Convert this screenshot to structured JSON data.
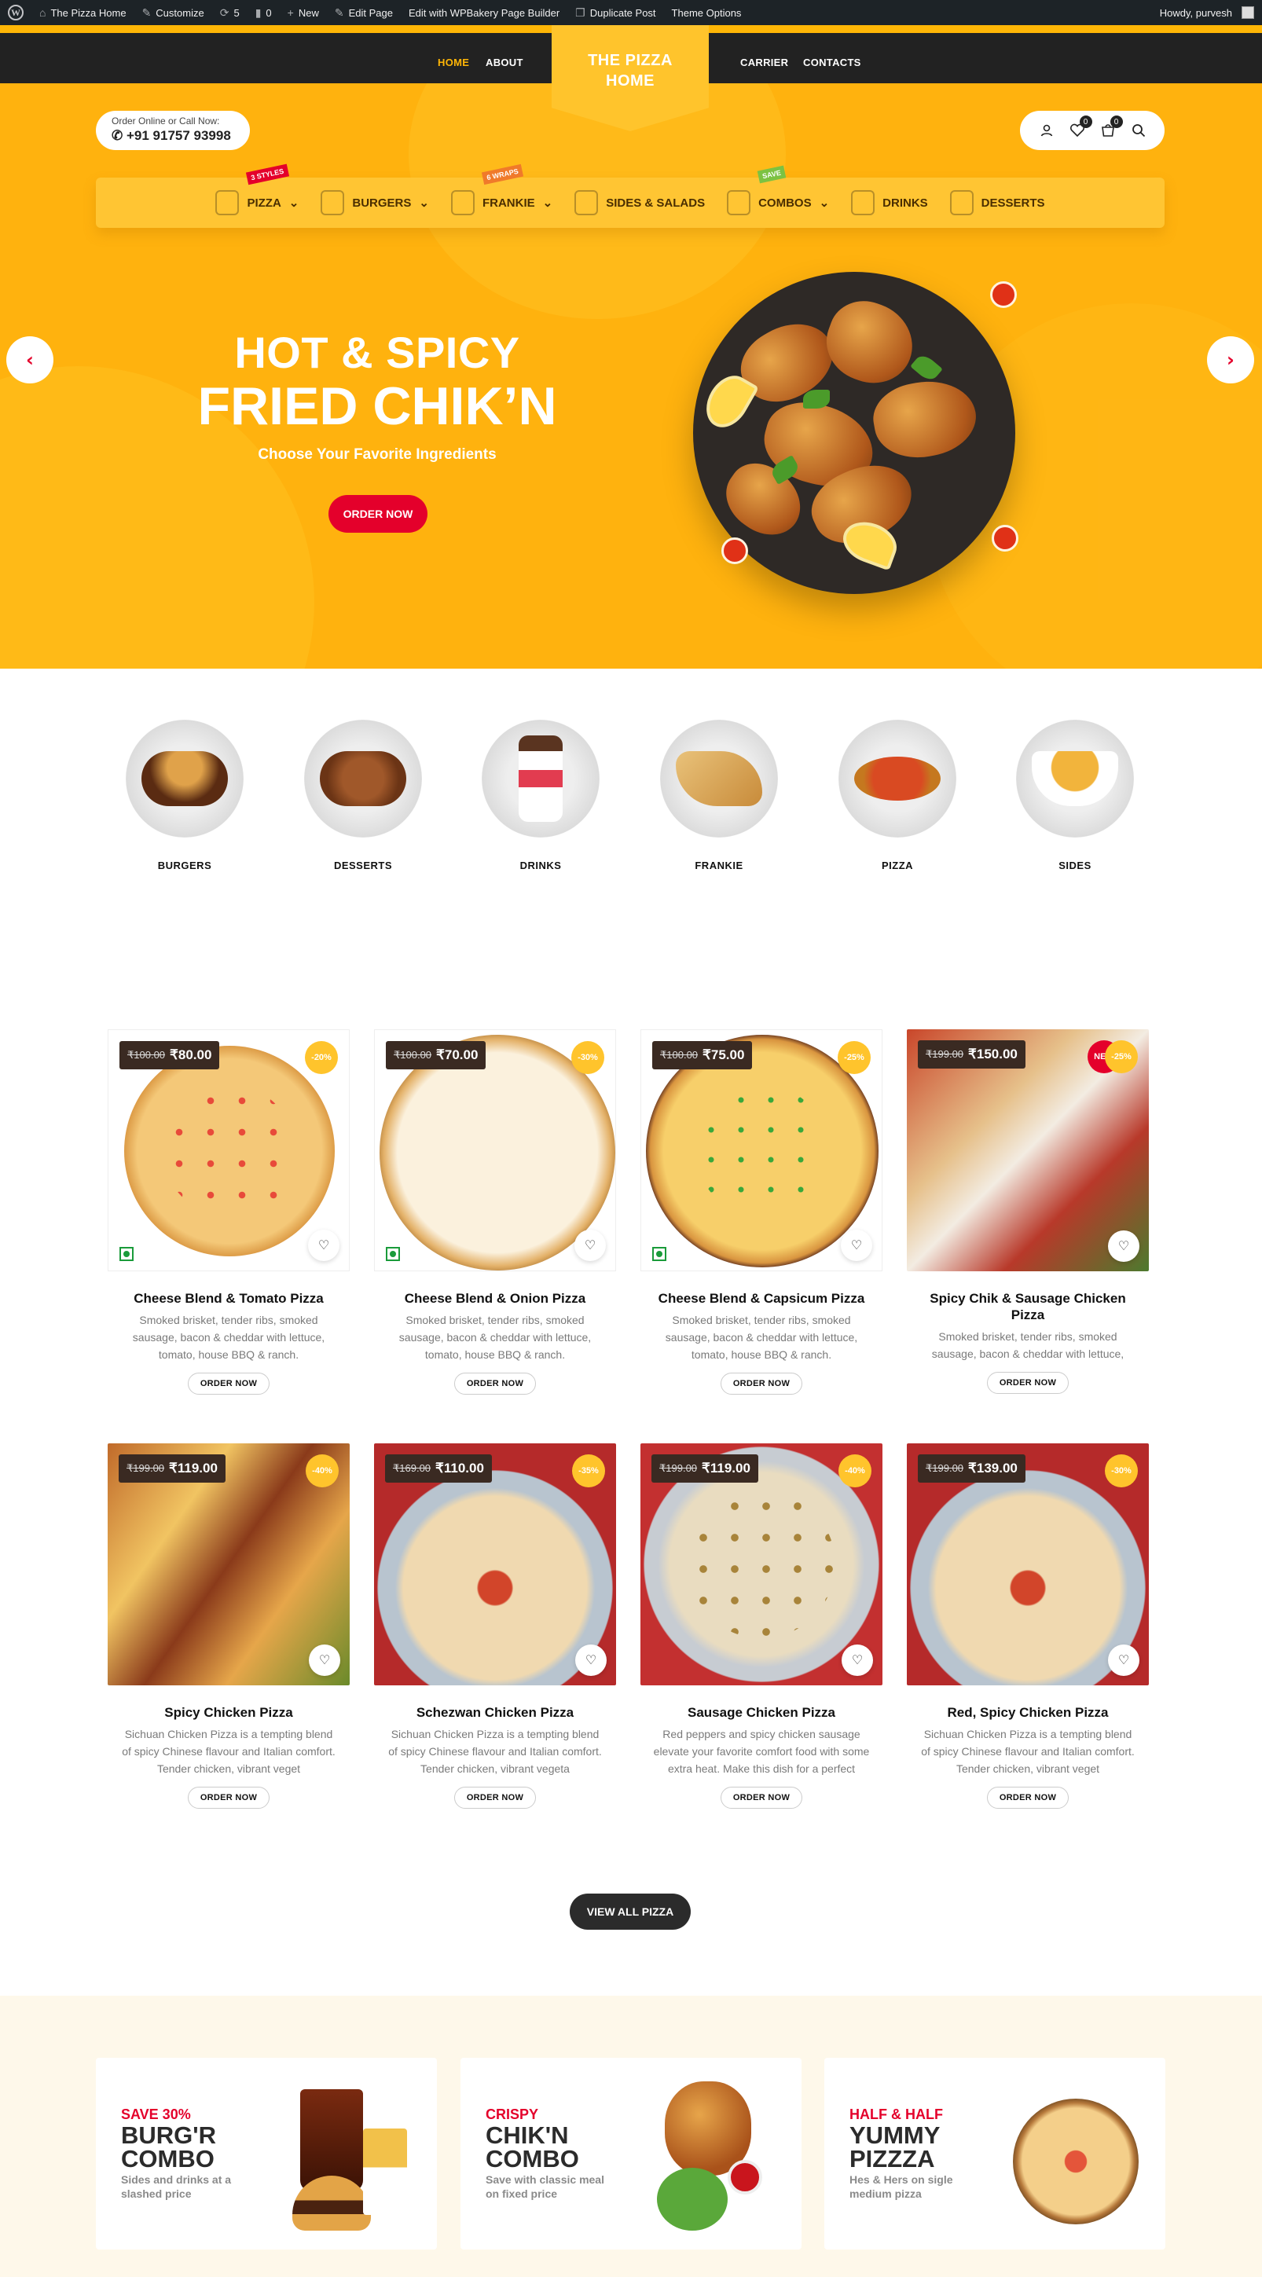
{
  "adminbar": {
    "site": "The Pizza Home",
    "customize": "Customize",
    "updates": "5",
    "comments": "0",
    "new": "New",
    "edit_page": "Edit Page",
    "wpbakery": "Edit with WPBakery Page Builder",
    "duplicate": "Duplicate Post",
    "theme_options": "Theme Options",
    "howdy": "Howdy, purvesh"
  },
  "nav": {
    "home": "HOME",
    "about": "ABOUT",
    "carrier": "CARRIER",
    "contacts": "CONTACTS",
    "logo_line1": "THE PIZZA",
    "logo_line2": "HOME"
  },
  "header": {
    "order_label": "Order Online or Call Now:",
    "phone": "+91 91757 93998",
    "wishlist_count": "0",
    "cart_count": "0"
  },
  "menu": [
    {
      "label": "PIZZA",
      "caret": "⌄",
      "tag": "3 STYLES",
      "tag_color": "#e4002b"
    },
    {
      "label": "BURGERS",
      "caret": "⌄",
      "tag": "",
      "tag_color": ""
    },
    {
      "label": "FRANKIE",
      "caret": "⌄",
      "tag": "6 WRAPS",
      "tag_color": "#f07a2a"
    },
    {
      "label": "SIDES & SALADS",
      "caret": "",
      "tag": "",
      "tag_color": ""
    },
    {
      "label": "COMBOS",
      "caret": "⌄",
      "tag": "SAVE",
      "tag_color": "#7cc242"
    },
    {
      "label": "DRINKS",
      "caret": "",
      "tag": "",
      "tag_color": ""
    },
    {
      "label": "DESSERTS",
      "caret": "",
      "tag": "",
      "tag_color": ""
    }
  ],
  "hero": {
    "title1": "HOT & SPICY",
    "title2": "FRIED CHIK’N",
    "subtitle": "Choose Your Favorite Ingredients",
    "button": "ORDER NOW",
    "prev": "‹",
    "next": "›"
  },
  "categories": [
    {
      "label": "BURGERS"
    },
    {
      "label": "DESSERTS"
    },
    {
      "label": "DRINKS"
    },
    {
      "label": "FRANKIE"
    },
    {
      "label": "PIZZA"
    },
    {
      "label": "SIDES"
    }
  ],
  "products": [
    {
      "name": "Cheese Blend & Tomato Pizza",
      "old_price": "₹100.00",
      "price": "₹80.00",
      "badge": "-20%",
      "desc": "Smoked brisket, tender ribs, smoked sausage, bacon & cheddar with lettuce, tomato, house BBQ & ranch.",
      "button": "ORDER NOW"
    },
    {
      "name": "Cheese Blend & Onion Pizza",
      "old_price": "₹100.00",
      "price": "₹70.00",
      "badge": "-30%",
      "desc": "Smoked brisket, tender ribs, smoked sausage, bacon & cheddar with lettuce, tomato, house BBQ & ranch.",
      "button": "ORDER NOW"
    },
    {
      "name": "Cheese Blend & Capsicum Pizza",
      "old_price": "₹100.00",
      "price": "₹75.00",
      "badge": "-25%",
      "desc": "Smoked brisket, tender ribs, smoked sausage, bacon & cheddar with lettuce, tomato, house BBQ & ranch.",
      "button": "ORDER NOW"
    },
    {
      "name": "Spicy Chik & Sausage Chicken Pizza",
      "old_price": "₹199.00",
      "price": "₹150.00",
      "badge": "NEW",
      "badge2": "-25%",
      "desc": "Smoked brisket, tender ribs, smoked sausage, bacon & cheddar with lettuce,",
      "button": "ORDER NOW"
    },
    {
      "name": "Spicy Chicken Pizza",
      "old_price": "₹199.00",
      "price": "₹119.00",
      "badge": "-40%",
      "desc": "Sichuan Chicken Pizza is a tempting blend of spicy Chinese flavour and Italian comfort. Tender chicken, vibrant veget",
      "button": "ORDER NOW"
    },
    {
      "name": "Schezwan Chicken Pizza",
      "old_price": "₹169.00",
      "price": "₹110.00",
      "badge": "-35%",
      "desc": "Sichuan Chicken Pizza is a tempting blend of spicy Chinese flavour and Italian comfort. Tender chicken, vibrant vegeta",
      "button": "ORDER NOW"
    },
    {
      "name": "Sausage Chicken Pizza",
      "old_price": "₹199.00",
      "price": "₹119.00",
      "badge": "-40%",
      "desc": "Red peppers and spicy chicken sausage elevate your favorite comfort food with some extra heat. Make this dish for a perfect",
      "button": "ORDER NOW"
    },
    {
      "name": "Red, Spicy Chicken Pizza",
      "old_price": "₹199.00",
      "price": "₹139.00",
      "badge": "-30%",
      "desc": "Sichuan Chicken Pizza is a tempting blend of spicy Chinese flavour and Italian comfort. Tender chicken, vibrant veget",
      "button": "ORDER NOW"
    }
  ],
  "view_all": "VIEW ALL PIZZA",
  "combos": [
    {
      "small": "SAVE 30%",
      "big1": "BURG'R",
      "big2": "COMBO",
      "desc": "Sides and drinks at a slashed price"
    },
    {
      "small": "CRISPY",
      "big1": "CHIK'N",
      "big2": "COMBO",
      "desc": "Save with classic meal on fixed price"
    },
    {
      "small": "HALF & HALF",
      "big1": "YUMMY",
      "big2": "PIZZZA",
      "desc": "Hes & Hers on sigle medium pizza"
    }
  ],
  "colors": {
    "accent": "#ffb606",
    "red": "#e4002b",
    "dark": "#222222"
  }
}
